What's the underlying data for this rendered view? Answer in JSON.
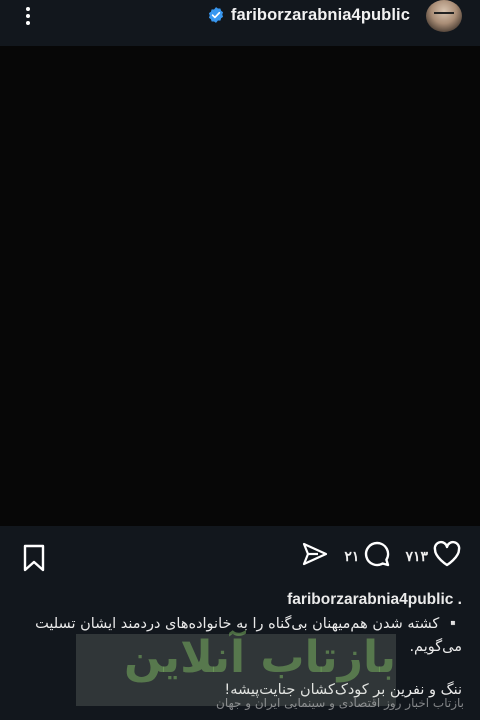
{
  "header": {
    "username": "fariborzarabnia4public",
    "verified": true,
    "menu_icon": "more-vertical-icon",
    "avatar_icon": "profile-avatar"
  },
  "media": {
    "background": "#070707"
  },
  "actions": {
    "likes_count": "۷۱۳",
    "comments_count": "۲۱",
    "like_icon": "heart-icon",
    "comment_icon": "comment-icon",
    "share_icon": "send-icon",
    "save_icon": "bookmark-icon"
  },
  "caption": {
    "author": "fariborzarabnia4public .",
    "line1": "▫️ کشته شدن هم‌میهنان بی‌گناه را به خانواده‌های دردمند ایشان تسلیت می‌گویم.",
    "line2": "ننگ و نفرین بر کودک‌کشان جنایت‌پیشه!"
  },
  "watermark": {
    "title": "بازتاب آنلاین",
    "subtitle": "بازتاب اخبار روز اقتصادی و سینمایی ایران و جهان"
  },
  "colors": {
    "bar_background": "#12171d",
    "verified_blue": "#3897f0",
    "text": "#f5f5f5"
  }
}
